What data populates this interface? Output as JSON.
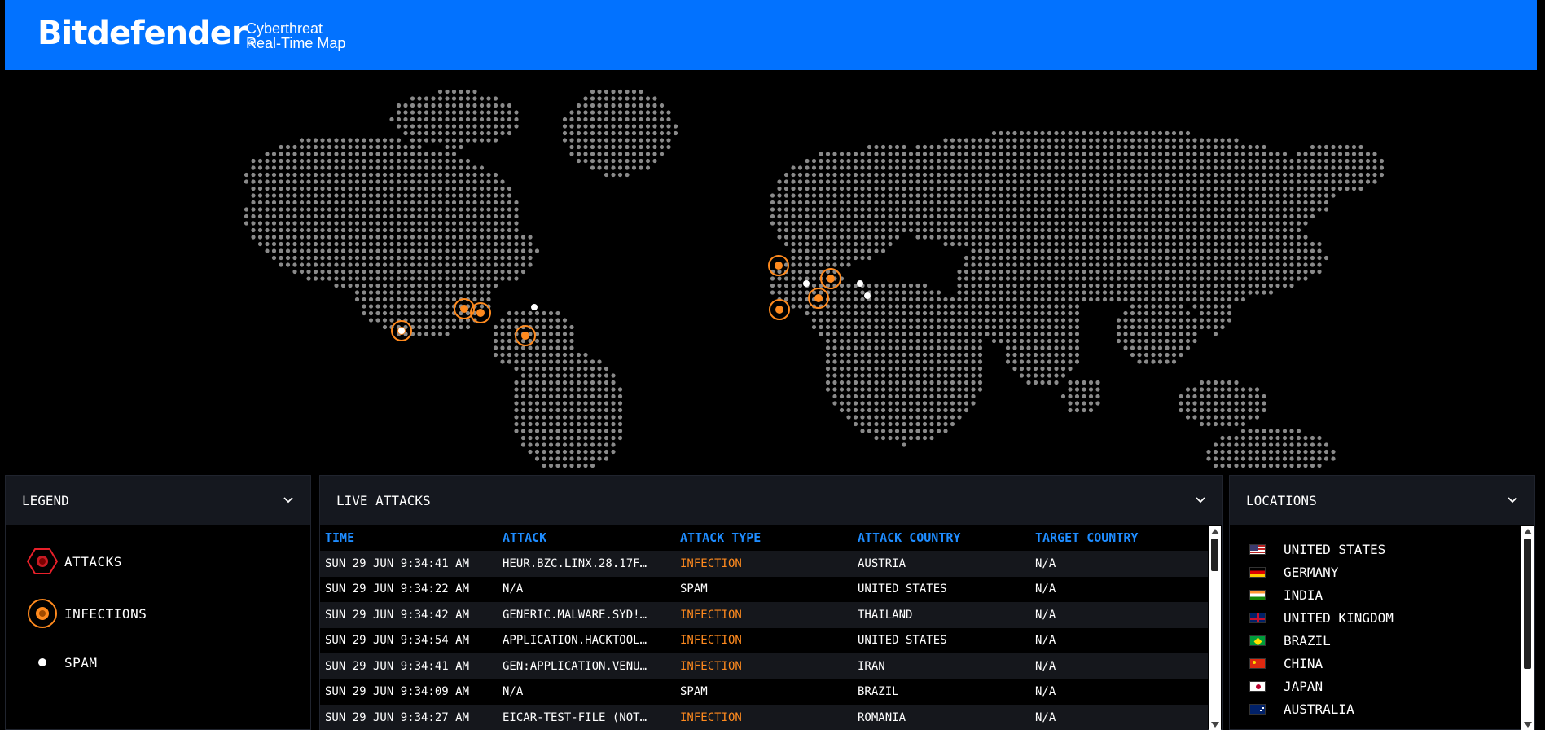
{
  "header": {
    "logo": "Bitdefender",
    "logo_mark": "®",
    "subtitle_line1": "Cyberthreat",
    "subtitle_line2": "Real-Time Map",
    "bg_color": "#0272ff"
  },
  "legend": {
    "title": "LEGEND",
    "items": [
      {
        "label": "ATTACKS",
        "icon": "attack-hexagon-icon",
        "color": "#e8202a"
      },
      {
        "label": "INFECTIONS",
        "icon": "infection-ring-icon",
        "color": "#ff8a1e"
      },
      {
        "label": "SPAM",
        "icon": "spam-dot-icon",
        "color": "#ffffff"
      }
    ]
  },
  "live_attacks": {
    "title": "LIVE ATTACKS",
    "columns": [
      "TIME",
      "ATTACK",
      "ATTACK TYPE",
      "ATTACK COUNTRY",
      "TARGET COUNTRY"
    ],
    "rows": [
      {
        "time": "SUN 29 JUN 9:34:41 AM",
        "attack": "HEUR.BZC.LINX.28.17F…",
        "type": "INFECTION",
        "country": "AUSTRIA",
        "target": "N/A"
      },
      {
        "time": "SUN 29 JUN 9:34:22 AM",
        "attack": "N/A",
        "type": "SPAM",
        "country": "UNITED STATES",
        "target": "N/A"
      },
      {
        "time": "SUN 29 JUN 9:34:42 AM",
        "attack": "GENERIC.MALWARE.SYD!…",
        "type": "INFECTION",
        "country": "THAILAND",
        "target": "N/A"
      },
      {
        "time": "SUN 29 JUN 9:34:54 AM",
        "attack": "APPLICATION.HACKTOOL…",
        "type": "INFECTION",
        "country": "UNITED STATES",
        "target": "N/A"
      },
      {
        "time": "SUN 29 JUN 9:34:41 AM",
        "attack": "GEN:APPLICATION.VENU…",
        "type": "INFECTION",
        "country": "IRAN",
        "target": "N/A"
      },
      {
        "time": "SUN 29 JUN 9:34:09 AM",
        "attack": "N/A",
        "type": "SPAM",
        "country": "BRAZIL",
        "target": "N/A"
      },
      {
        "time": "SUN 29 JUN 9:34:27 AM",
        "attack": "EICAR-TEST-FILE (NOT…",
        "type": "INFECTION",
        "country": "ROMANIA",
        "target": "N/A"
      }
    ]
  },
  "locations": {
    "title": "LOCATIONS",
    "items": [
      {
        "name": "UNITED STATES",
        "flag": "us-flag-icon"
      },
      {
        "name": "GERMANY",
        "flag": "de-flag-icon"
      },
      {
        "name": "INDIA",
        "flag": "in-flag-icon"
      },
      {
        "name": "UNITED KINGDOM",
        "flag": "gb-flag-icon"
      },
      {
        "name": "BRAZIL",
        "flag": "br-flag-icon"
      },
      {
        "name": "CHINA",
        "flag": "cn-flag-icon"
      },
      {
        "name": "JAPAN",
        "flag": "jp-flag-icon"
      },
      {
        "name": "AUSTRALIA",
        "flag": "au-flag-icon"
      }
    ]
  },
  "colors": {
    "infection": "#ff8a1e",
    "column_header": "#1e8cff",
    "map_dot": "#8a8a8a"
  }
}
